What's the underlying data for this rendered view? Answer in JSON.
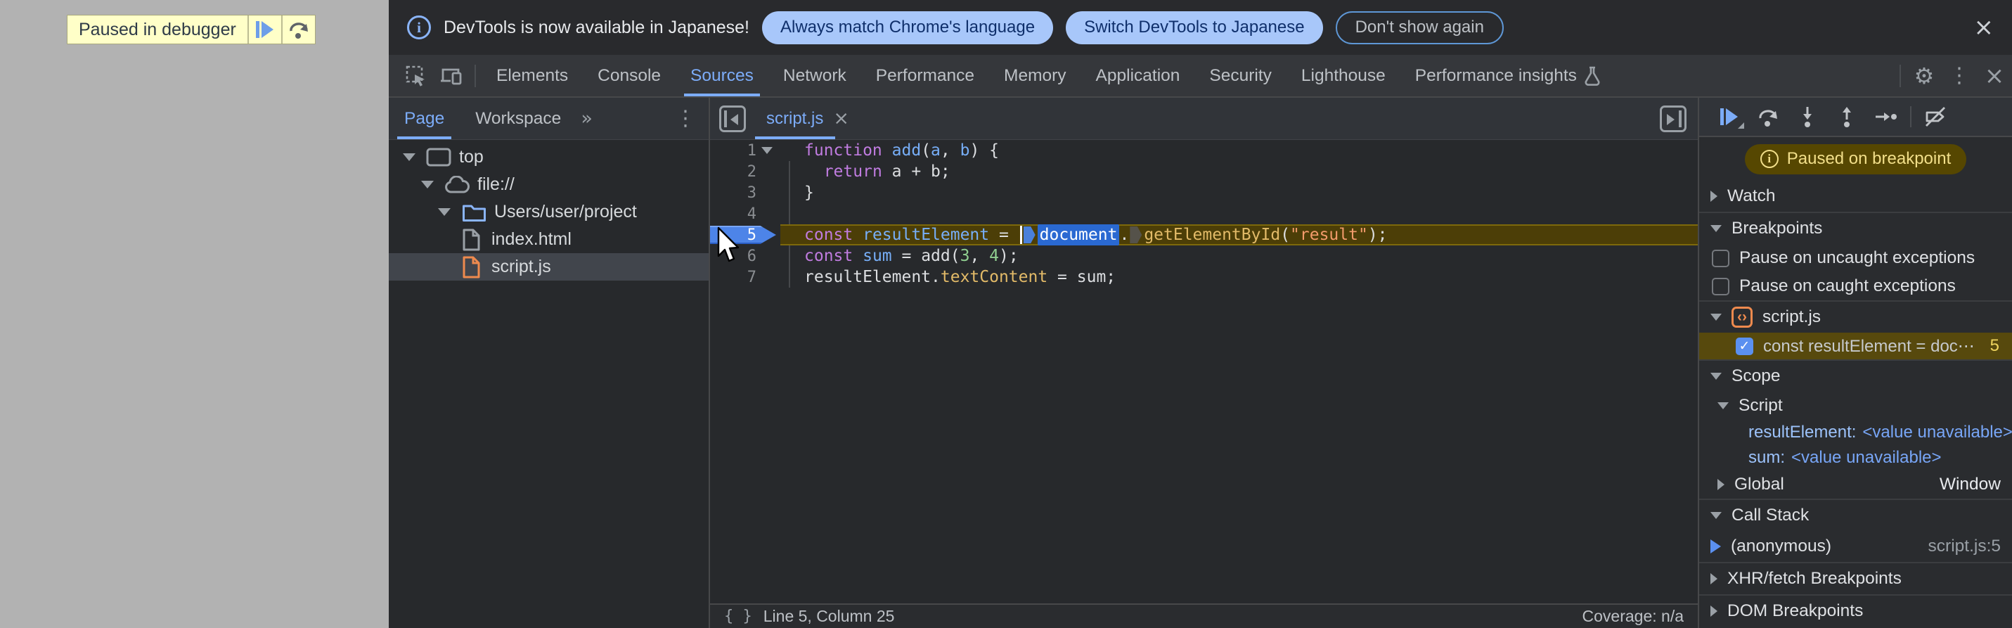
{
  "colors": {
    "accent_blue": "#7cacf8",
    "exec_line_bg": "#4c3e07",
    "paused_pill_bg": "#564701",
    "badge_yellow": "#ffffc8",
    "selection_blue": "#2a69d2",
    "orange_file": "#ee8a4e"
  },
  "icons": {
    "check": "✓",
    "gear": "⚙",
    "more_vertical": "⋮",
    "chevron_double": "»",
    "close": "×",
    "braces": "{ }",
    "info_i": "i",
    "code_brackets": "‹›"
  },
  "page": {
    "paused_badge": {
      "label": "Paused in debugger"
    }
  },
  "infobar": {
    "message": "DevTools is now available in Japanese!",
    "primary_button": "Always match Chrome's language",
    "secondary_button": "Switch DevTools to Japanese",
    "dismiss_button": "Don't show again"
  },
  "toolbar": {
    "tabs": {
      "elements": "Elements",
      "console": "Console",
      "sources": "Sources",
      "network": "Network",
      "performance": "Performance",
      "memory": "Memory",
      "application": "Application",
      "security": "Security",
      "lighthouse": "Lighthouse",
      "performance_insights": "Performance insights"
    },
    "active_tab": "Sources"
  },
  "sidebar": {
    "tabs": {
      "page": "Page",
      "workspace": "Workspace"
    },
    "active_tab": "Page",
    "tree": {
      "top": "top",
      "file_scheme": "file://",
      "folder": "Users/user/project",
      "index_html": "index.html",
      "script_js": "script.js"
    }
  },
  "editor": {
    "tab": "script.js",
    "status": {
      "line_col": "Line 5, Column 25",
      "coverage": "Coverage: n/a"
    },
    "code": {
      "lines": [
        {
          "num": "1",
          "fold": true,
          "tokens": [
            {
              "t": "function",
              "c": "kw"
            },
            {
              "t": " ",
              "c": "plain"
            },
            {
              "t": "add",
              "c": "blue"
            },
            {
              "t": "(",
              "c": "plain"
            },
            {
              "t": "a",
              "c": "blue"
            },
            {
              "t": ", ",
              "c": "plain"
            },
            {
              "t": "b",
              "c": "blue"
            },
            {
              "t": ") {",
              "c": "plain"
            }
          ]
        },
        {
          "num": "2",
          "tokens": [
            {
              "t": "  ",
              "c": "plain"
            },
            {
              "t": "return",
              "c": "kw"
            },
            {
              "t": " a + b;",
              "c": "plain"
            }
          ]
        },
        {
          "num": "3",
          "tokens": [
            {
              "t": "}",
              "c": "plain"
            }
          ]
        },
        {
          "num": "4",
          "tokens": []
        },
        {
          "num": "5",
          "exec": true,
          "breakpoint": true,
          "tokens": [
            {
              "t": "const",
              "c": "kw"
            },
            {
              "t": " ",
              "c": "plain"
            },
            {
              "t": "resultElement",
              "c": "blue"
            },
            {
              "t": " = ",
              "c": "plain"
            },
            {
              "t": "",
              "c": "caret"
            },
            {
              "t": "",
              "c": "marker-blue"
            },
            {
              "t": "document",
              "c": "selected"
            },
            {
              "t": ".",
              "c": "plain"
            },
            {
              "t": "",
              "c": "marker-dark"
            },
            {
              "t": "getElementById",
              "c": "prop"
            },
            {
              "t": "(",
              "c": "plain"
            },
            {
              "t": "\"result\"",
              "c": "str"
            },
            {
              "t": ");",
              "c": "plain"
            }
          ]
        },
        {
          "num": "6",
          "tokens": [
            {
              "t": "const",
              "c": "kw"
            },
            {
              "t": " ",
              "c": "plain"
            },
            {
              "t": "sum",
              "c": "blue"
            },
            {
              "t": " = add(",
              "c": "plain"
            },
            {
              "t": "3",
              "c": "num"
            },
            {
              "t": ", ",
              "c": "plain"
            },
            {
              "t": "4",
              "c": "num"
            },
            {
              "t": ");",
              "c": "plain"
            }
          ]
        },
        {
          "num": "7",
          "tokens": [
            {
              "t": "resultElement.",
              "c": "plain"
            },
            {
              "t": "textContent",
              "c": "prop"
            },
            {
              "t": " = sum;",
              "c": "plain"
            }
          ]
        }
      ]
    }
  },
  "debugger": {
    "paused_pill": "Paused on breakpoint",
    "watch_title": "Watch",
    "breakpoints": {
      "title": "Breakpoints",
      "pause_uncaught": "Pause on uncaught exceptions",
      "pause_uncaught_checked": false,
      "pause_caught": "Pause on caught exceptions",
      "pause_caught_checked": false,
      "file": "script.js",
      "entry": {
        "text": "const resultElement = doc⋯",
        "line": "5",
        "checked": true
      }
    },
    "scope": {
      "title": "Scope",
      "script_group": "Script",
      "vars": [
        {
          "name": "resultElement:",
          "value": "<value unavailable>"
        },
        {
          "name": "sum:",
          "value": "<value unavailable>"
        }
      ],
      "global_group": "Global",
      "global_value": "Window"
    },
    "call_stack": {
      "title": "Call Stack",
      "frame_name": "(anonymous)",
      "frame_location": "script.js:5"
    },
    "xhr_title": "XHR/fetch Breakpoints",
    "dom_title": "DOM Breakpoints"
  }
}
